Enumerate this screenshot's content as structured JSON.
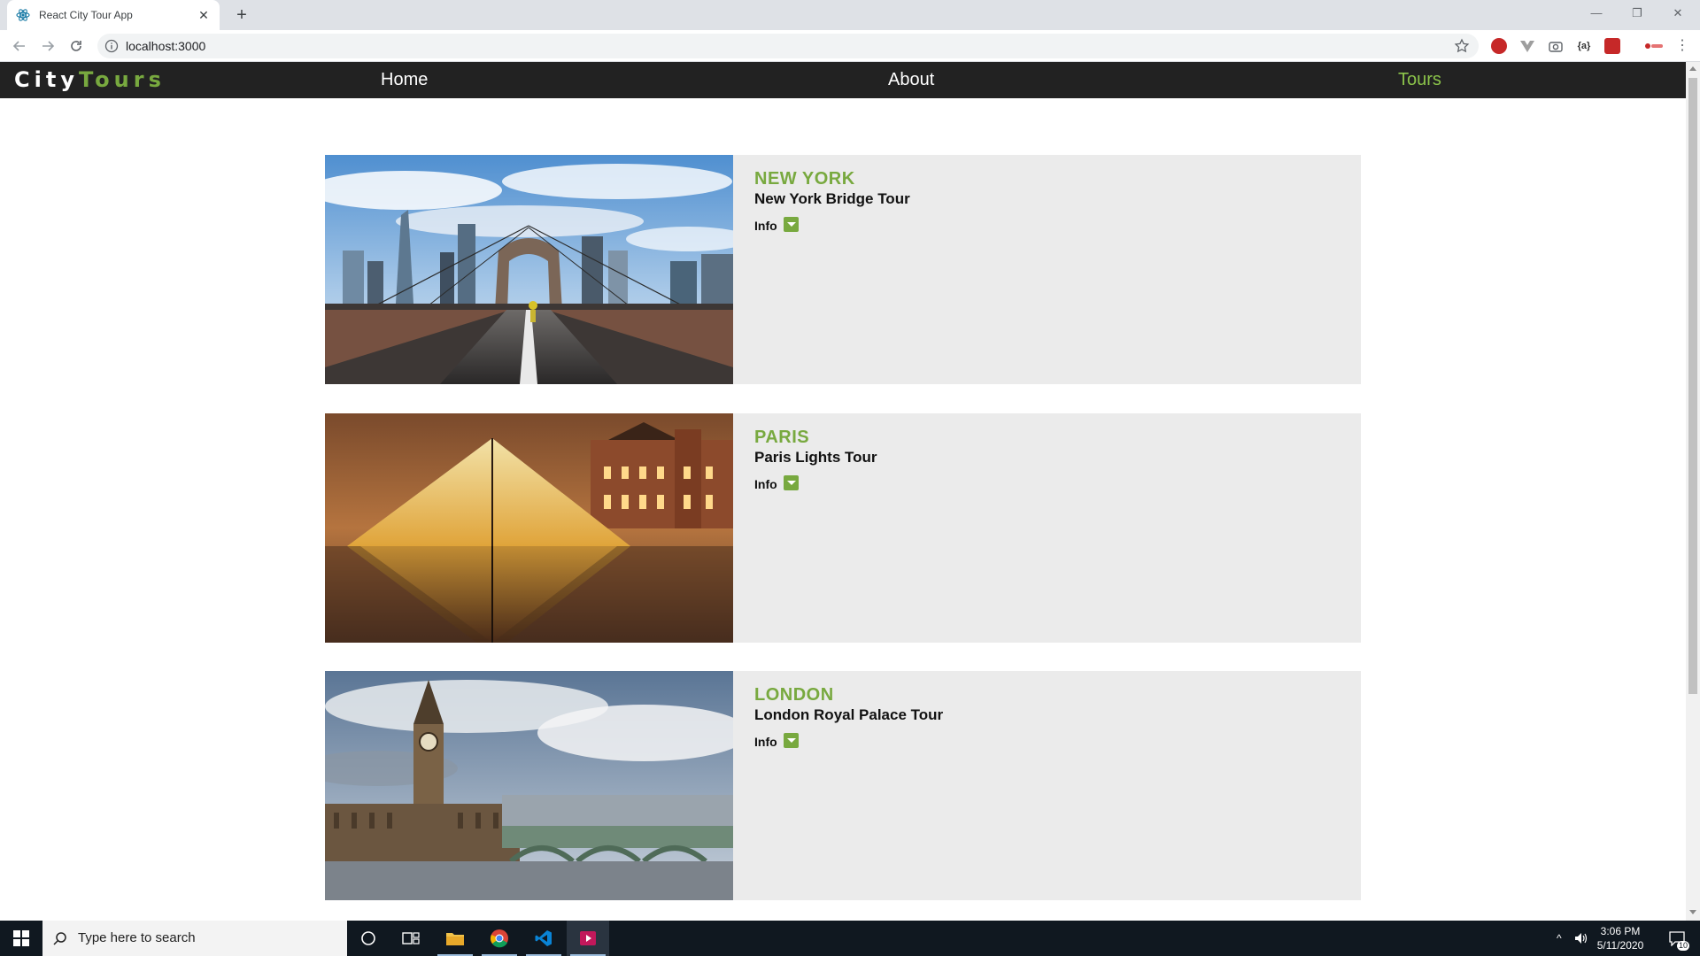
{
  "browser": {
    "tab_title": "React City Tour App",
    "url": "localhost:3000"
  },
  "app": {
    "brand_part1": "City",
    "brand_part2": "Tours",
    "nav": {
      "home": "Home",
      "about": "About",
      "tours": "Tours"
    },
    "accent_color": "#78a93f"
  },
  "tours": [
    {
      "city": "NEW YORK",
      "name": "New York Bridge Tour",
      "info_label": "Info"
    },
    {
      "city": "PARIS",
      "name": "Paris Lights Tour",
      "info_label": "Info"
    },
    {
      "city": "LONDON",
      "name": "London Royal Palace Tour",
      "info_label": "Info"
    }
  ],
  "taskbar": {
    "search_placeholder": "Type here to search",
    "time": "3:06 PM",
    "date": "5/11/2020",
    "notifications": "10"
  }
}
